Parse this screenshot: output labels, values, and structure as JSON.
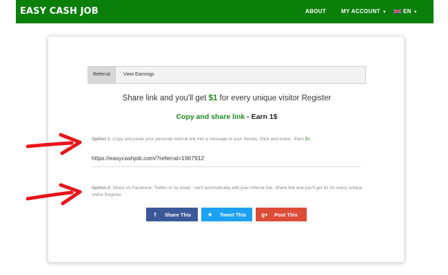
{
  "header": {
    "brand": "EASY CASH JOB",
    "nav": {
      "about": "ABOUT",
      "account": "MY ACCOUNT",
      "language": "EN"
    }
  },
  "tabs": [
    {
      "label": "Referral"
    },
    {
      "label": "View Earnings"
    }
  ],
  "headline": {
    "prefix": "Share link and you'll get ",
    "amount": "$1",
    "suffix": " for every unique visitor Register"
  },
  "subhead": {
    "green": "Copy and share link",
    "dark": " - Earn 1$"
  },
  "option1": {
    "label": "Option 1:",
    "text": " Copy and paste your personal referral link into a message to your friends. Click and share - Earn ",
    "amount": "$1"
  },
  "referral_link": "https://easycashjob.com/?referral=1967912",
  "option2": {
    "label": "Option 2:",
    "text": " Share on Facebook, Twitter or by email - we'll automatically add your referral link. Share link and you'll get $1 for every unique visitor Register"
  },
  "buttons": {
    "facebook": {
      "icon": "f",
      "label": "Share This"
    },
    "twitter": {
      "icon": "✈",
      "label": "Tweet This"
    },
    "google": {
      "icon": "g+",
      "label": "Post This"
    }
  },
  "colors": {
    "navbar": "#0a800a",
    "accent_green": "#1f8a1f",
    "facebook": "#3b5998",
    "twitter": "#1da1f2",
    "google": "#dd4b39",
    "arrow": "#e8141c"
  }
}
